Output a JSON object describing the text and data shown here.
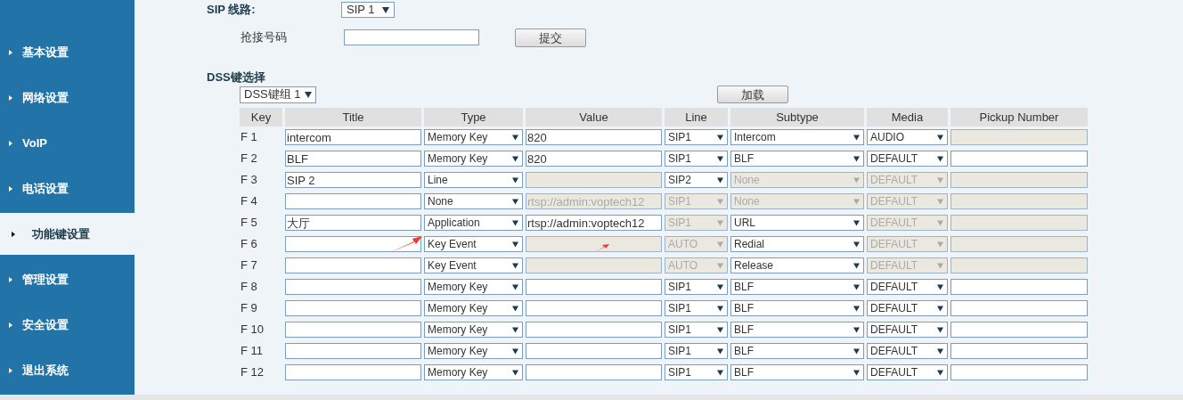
{
  "sidebar": {
    "items": [
      {
        "label": "基本设置",
        "selected": false
      },
      {
        "label": "网络设置",
        "selected": false
      },
      {
        "label": "VoIP",
        "selected": false
      },
      {
        "label": "电话设置",
        "selected": false
      },
      {
        "label": "功能键设置",
        "selected": true
      },
      {
        "label": "管理设置",
        "selected": false
      },
      {
        "label": "安全设置",
        "selected": false
      },
      {
        "label": "退出系统",
        "selected": false
      }
    ]
  },
  "sip_line": {
    "label": "SIP 线路:",
    "value": "SIP 1"
  },
  "pickup": {
    "label": "抢接号码",
    "button": "提交"
  },
  "dss": {
    "heading": "DSS键选择",
    "group": "DSS键组 1",
    "load_button": "加载"
  },
  "table": {
    "columns": [
      "Key",
      "Title",
      "Type",
      "Value",
      "Line",
      "Subtype",
      "Media",
      "Pickup Number"
    ],
    "rows": [
      {
        "key": "F 1",
        "title": "intercom",
        "type": "Memory Key",
        "value": "820",
        "value_disabled": false,
        "line": "SIP1",
        "line_disabled": false,
        "subtype": "Intercom",
        "subtype_disabled": false,
        "media": "AUDIO",
        "media_disabled": false,
        "pickup_disabled": true
      },
      {
        "key": "F 2",
        "title": "BLF",
        "type": "Memory Key",
        "value": "820",
        "value_disabled": false,
        "line": "SIP1",
        "line_disabled": false,
        "subtype": "BLF",
        "subtype_disabled": false,
        "media": "DEFAULT",
        "media_disabled": false,
        "pickup_disabled": false
      },
      {
        "key": "F 3",
        "title": "SIP 2",
        "type": "Line",
        "value_disabled": true,
        "line": "SIP2",
        "line_disabled": false,
        "subtype": "None",
        "subtype_disabled": true,
        "media": "DEFAULT",
        "media_disabled": true,
        "pickup_disabled": true
      },
      {
        "key": "F 4",
        "type": "None",
        "value": "rtsp://admin:voptech12",
        "value_disabled": true,
        "line": "SIP1",
        "line_disabled": true,
        "subtype": "None",
        "subtype_disabled": true,
        "media": "DEFAULT",
        "media_disabled": true,
        "pickup_disabled": true
      },
      {
        "key": "F 5",
        "title": "大厅",
        "type": "Application",
        "value": "rtsp://admin:voptech12",
        "value_disabled": false,
        "line": "SIP1",
        "line_disabled": true,
        "subtype": "URL",
        "subtype_disabled": false,
        "media": "DEFAULT",
        "media_disabled": true,
        "pickup_disabled": true
      },
      {
        "key": "F 6",
        "type": "Key Event",
        "value_disabled": true,
        "line": "AUTO",
        "line_disabled": true,
        "subtype": "Redial",
        "subtype_disabled": false,
        "media": "DEFAULT",
        "media_disabled": true,
        "pickup_disabled": true
      },
      {
        "key": "F 7",
        "type": "Key Event",
        "value_disabled": true,
        "line": "AUTO",
        "line_disabled": true,
        "subtype": "Release",
        "subtype_disabled": false,
        "media": "DEFAULT",
        "media_disabled": true,
        "pickup_disabled": true
      },
      {
        "key": "F 8",
        "type": "Memory Key",
        "value_disabled": false,
        "line": "SIP1",
        "line_disabled": false,
        "subtype": "BLF",
        "subtype_disabled": false,
        "media": "DEFAULT",
        "media_disabled": false,
        "pickup_disabled": false
      },
      {
        "key": "F 9",
        "type": "Memory Key",
        "value_disabled": false,
        "line": "SIP1",
        "line_disabled": false,
        "subtype": "BLF",
        "subtype_disabled": false,
        "media": "DEFAULT",
        "media_disabled": false,
        "pickup_disabled": false
      },
      {
        "key": "F 10",
        "type": "Memory Key",
        "value_disabled": false,
        "line": "SIP1",
        "line_disabled": false,
        "subtype": "BLF",
        "subtype_disabled": false,
        "media": "DEFAULT",
        "media_disabled": false,
        "pickup_disabled": false
      },
      {
        "key": "F 11",
        "type": "Memory Key",
        "value_disabled": false,
        "line": "SIP1",
        "line_disabled": false,
        "subtype": "BLF",
        "subtype_disabled": false,
        "media": "DEFAULT",
        "media_disabled": false,
        "pickup_disabled": false
      },
      {
        "key": "F 12",
        "type": "Memory Key",
        "value_disabled": false,
        "line": "SIP1",
        "line_disabled": false,
        "subtype": "BLF",
        "subtype_disabled": false,
        "media": "DEFAULT",
        "media_disabled": false,
        "pickup_disabled": false
      }
    ]
  }
}
